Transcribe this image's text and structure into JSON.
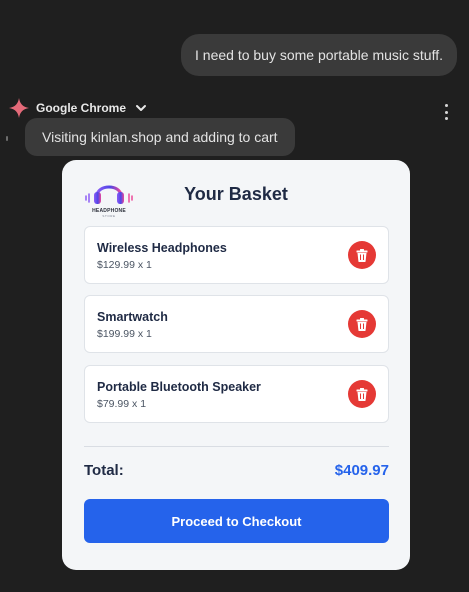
{
  "chat": {
    "user_message": "I need to buy some portable music stuff."
  },
  "agent": {
    "name": "Google Chrome",
    "status": "Visiting kinlan.shop and adding to cart"
  },
  "basket": {
    "logo_text": "HEADPHONE",
    "logo_subtext": "STORE",
    "title": "Your Basket",
    "items": [
      {
        "name": "Wireless Headphones",
        "price_qty": "$129.99 x 1"
      },
      {
        "name": "Smartwatch",
        "price_qty": "$199.99 x 1"
      },
      {
        "name": "Portable Bluetooth Speaker",
        "price_qty": "$79.99 x 1"
      }
    ],
    "total_label": "Total:",
    "total_value": "$409.97",
    "checkout_label": "Proceed to Checkout"
  },
  "icons": {
    "agent": "sparkle-icon",
    "agent_menu": "chevron-down-icon",
    "more": "more-vert-icon",
    "delete": "trash-icon",
    "logo": "headphones-icon"
  },
  "colors": {
    "background": "#1f1f1f",
    "bubble": "#3a3a3a",
    "accent_blue": "#2563eb",
    "delete_red": "#e53935",
    "sparkle": "#e46a79"
  }
}
